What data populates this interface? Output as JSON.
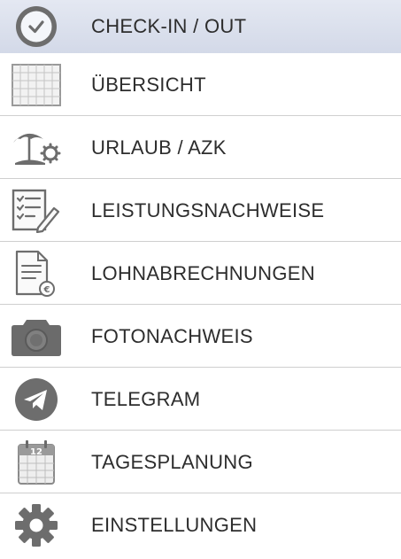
{
  "menu": {
    "items": [
      {
        "label": "CHECK-IN / OUT",
        "icon": "clock-icon",
        "selected": true
      },
      {
        "label": "ÜBERSICHT",
        "icon": "calendar-grid-icon"
      },
      {
        "label": "URLAUB / AZK",
        "icon": "beach-umbrella-gear-icon"
      },
      {
        "label": "LEISTUNGSNACHWEISE",
        "icon": "checklist-pencil-icon"
      },
      {
        "label": "LOHNABRECHNUNGEN",
        "icon": "document-euro-icon"
      },
      {
        "label": "FOTONACHWEIS",
        "icon": "camera-icon"
      },
      {
        "label": "TELEGRAM",
        "icon": "telegram-icon"
      },
      {
        "label": "TAGESPLANUNG",
        "icon": "calendar-12-icon"
      },
      {
        "label": "EINSTELLUNGEN",
        "icon": "gear-icon"
      }
    ]
  },
  "colors": {
    "selected_background": "#d9deeb",
    "divider": "#cfcfcf",
    "text": "#2d2d2d",
    "icon": "#6a6a6a"
  }
}
